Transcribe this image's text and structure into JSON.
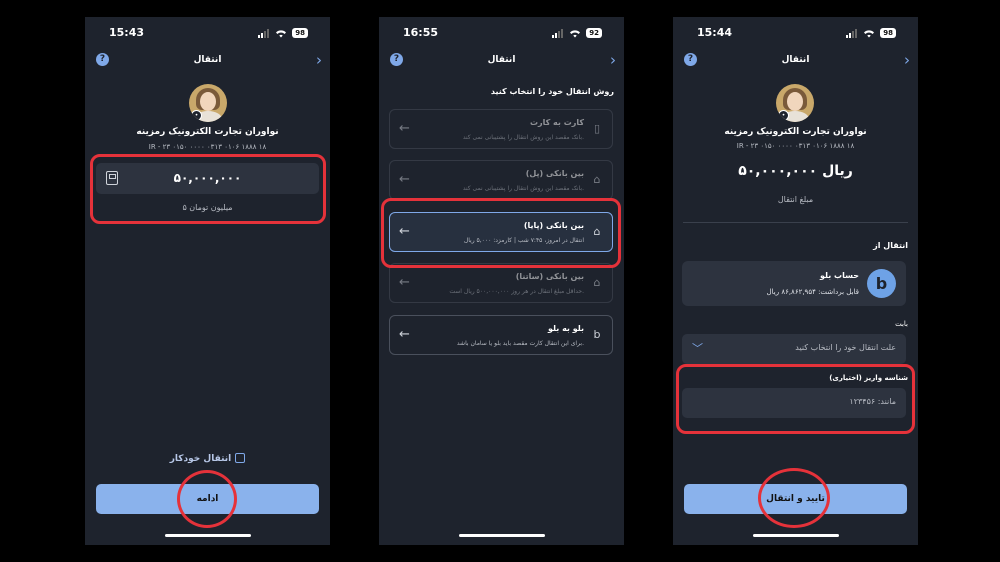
{
  "screen1": {
    "time": "15:43",
    "battery": "98",
    "header_title": "انتقال",
    "merchant_name": "نواوران تجارت الکترونیک رمزینه",
    "iban": "IR - ۲۳ ۰۱۵۰ ۰۰۰۰ ۰۳۱۳ ۰۱۰۶ ۱۸۸۸ ۱۸",
    "amount": "۵۰,۰۰۰,۰۰۰",
    "amount_words": "۵ میلیون تومان",
    "auto_transfer": "انتقال خودکار",
    "continue_label": "ادامه"
  },
  "screen2": {
    "time": "16:55",
    "battery": "92",
    "header_title": "انتقال",
    "section_title": "روش انتقال خود را انتخاب کنید",
    "options": [
      {
        "title": "کارت به کارت",
        "desc": "بانک مقصد این روش انتقال را پشتیبانی نمی کند."
      },
      {
        "title": "بین بانکی (پل)",
        "desc": "بانک مقصد این روش انتقال را پشتیبانی نمی کند."
      },
      {
        "title": "بین بانکی (پایا)",
        "desc": "انتقال در امروز، ۷:۴۵ شب | کارمزد: ۵,۰۰۰ ریال"
      },
      {
        "title": "بین بانکی (ساتنا)",
        "desc": "حداقل مبلغ انتقال در هر روز ۵۰۰,۰۰۰,۰۰۰ ریال است."
      },
      {
        "title": "بلو به بلو",
        "desc": "برای این انتقال کارت مقصد باید بلو یا سامان باشد."
      }
    ]
  },
  "screen3": {
    "time": "15:44",
    "battery": "98",
    "header_title": "انتقال",
    "merchant_name": "نواوران تجارت الکترونیک رمزینه",
    "iban": "IR - ۲۳ ۰۱۵۰ ۰۰۰۰ ۰۳۱۳ ۰۱۰۶ ۱۸۸۸ ۱۸",
    "amount": "۵۰,۰۰۰,۰۰۰ ریال",
    "amount_label": "مبلغ انتقال",
    "from_label": "انتقال از",
    "account_name": "حساب بلو",
    "account_balance": "قابل برداشت: ۸۶,۸۶۲,۹۵۴ ریال",
    "account_logo": "b",
    "reason_label": "بابت",
    "reason_placeholder": "علت انتقال خود را انتخاب کنید",
    "deposit_id_label": "شناسه واریز (اختیاری)",
    "deposit_id_placeholder": "مانند: ۱۲۳۴۵۶",
    "confirm_label": "تایید و انتقال"
  },
  "colors": {
    "background": "#1e232d",
    "accent": "#8ab2ec",
    "highlight": "#e5323a"
  }
}
